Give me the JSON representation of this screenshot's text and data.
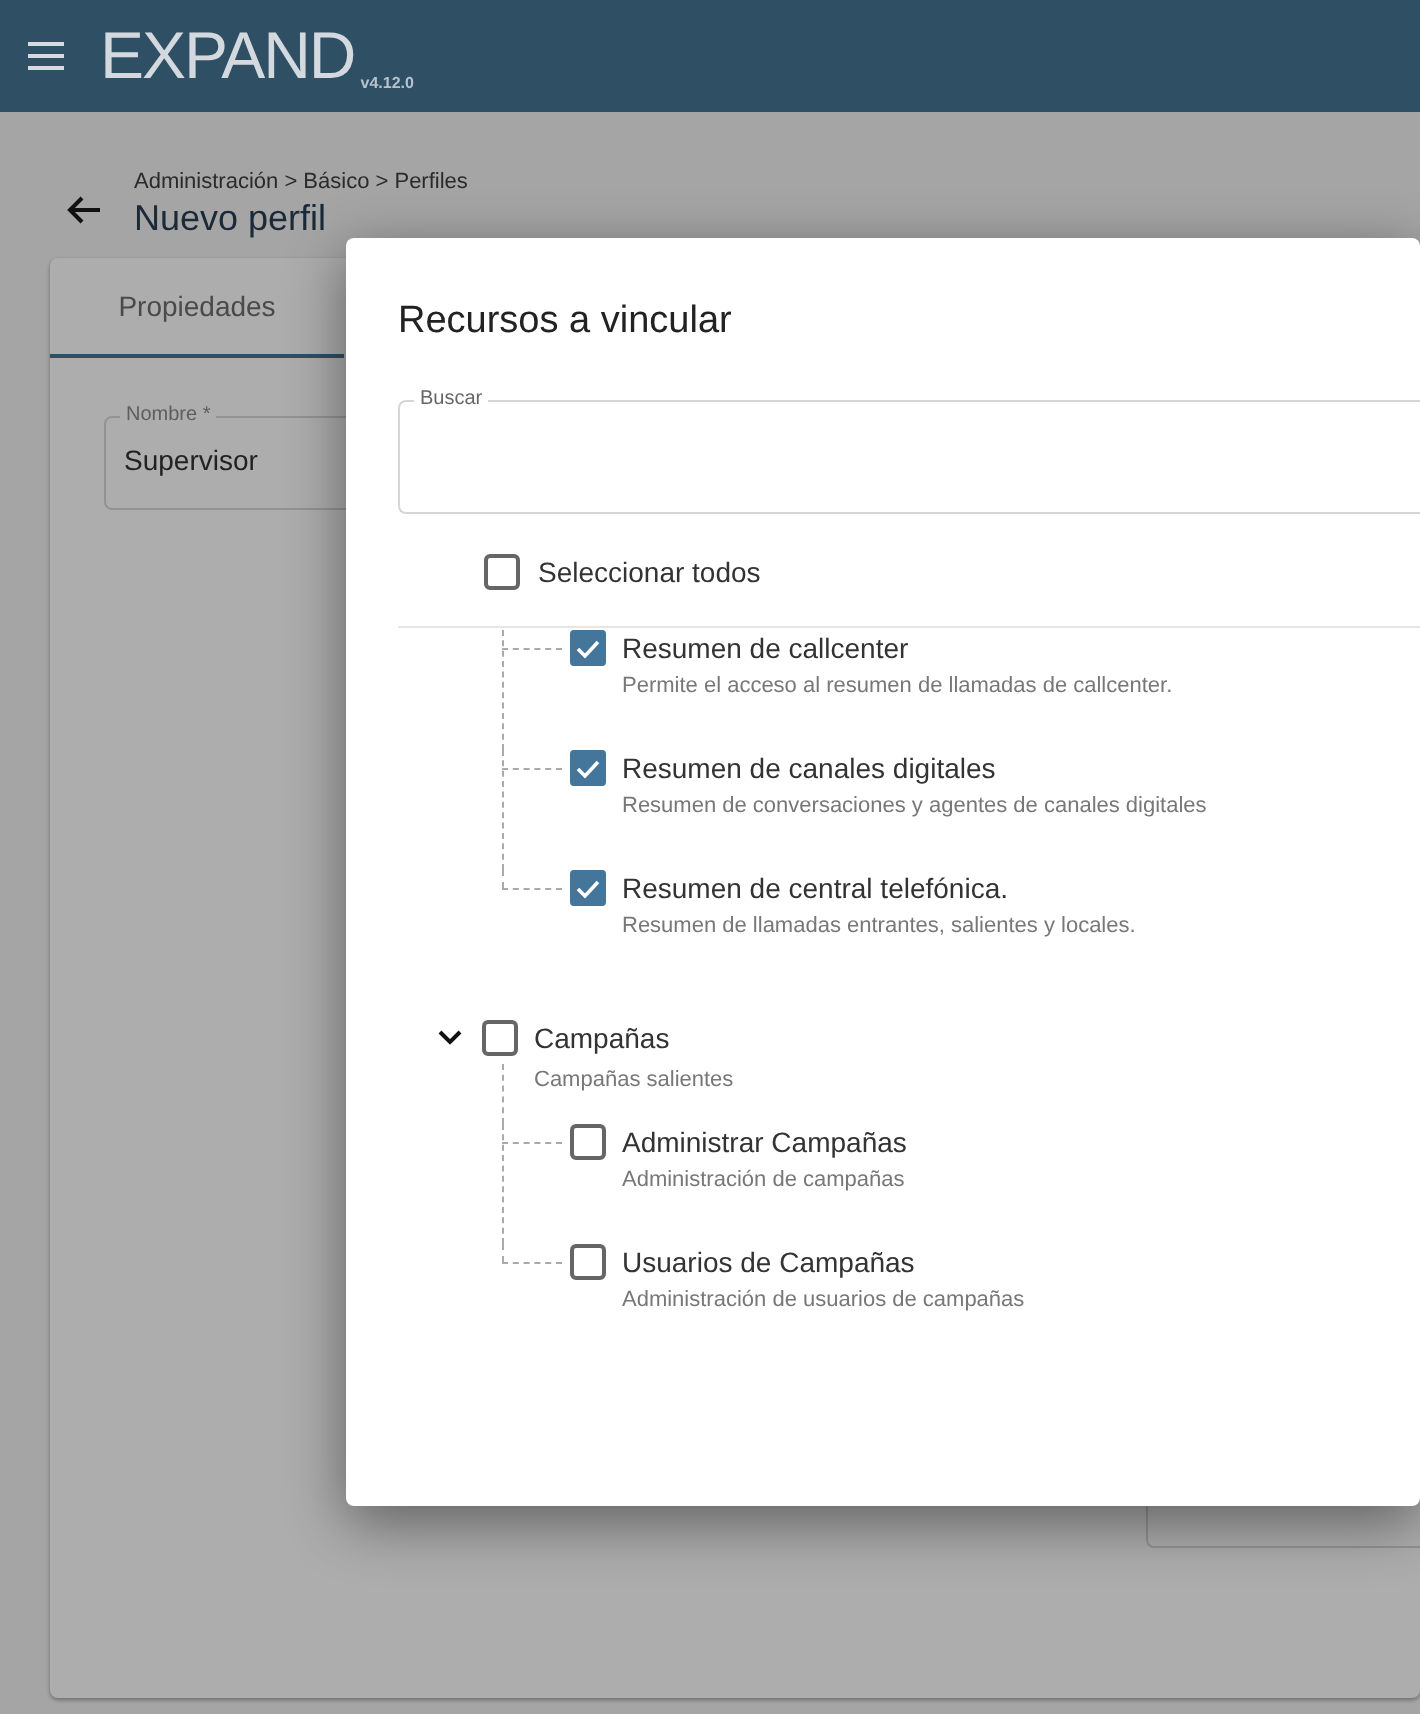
{
  "app_bar": {
    "logo": "EXPAND",
    "version": "v4.12.0"
  },
  "page": {
    "breadcrumb": "Administración > Básico > Perfiles",
    "title": "Nuevo perfil"
  },
  "tabs": [
    {
      "label": "Propiedades",
      "selected": true
    }
  ],
  "name_field": {
    "label": "Nombre *",
    "value": "Supervisor"
  },
  "dialog": {
    "title": "Recursos a vincular",
    "search": {
      "label": "Buscar"
    },
    "select_all": {
      "label": "Seleccionar todos",
      "checked": false
    },
    "tree": [
      {
        "children": [
          {
            "label": "Resumen de callcenter",
            "description": "Permite el acceso al resumen de llamadas de callcenter.",
            "checked": true
          },
          {
            "label": "Resumen de canales digitales",
            "description": "Resumen de conversaciones y agentes de canales digitales",
            "checked": true
          },
          {
            "label": "Resumen de central telefónica.",
            "description": "Resumen de llamadas entrantes, salientes y locales.",
            "checked": true
          }
        ]
      },
      {
        "label": "Campañas",
        "description": "Campañas salientes",
        "checked": false,
        "expanded": true,
        "children": [
          {
            "label": "Administrar Campañas",
            "description": "Administración de campañas",
            "checked": false
          },
          {
            "label": "Usuarios de Campañas",
            "description": "Administración de usuarios de campañas",
            "checked": false
          }
        ]
      }
    ]
  }
}
